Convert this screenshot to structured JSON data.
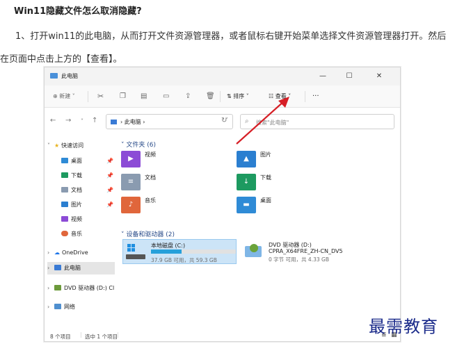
{
  "article": {
    "title": "Win11隐藏文件怎么取消隐藏?",
    "step1": "1、打开win11的此电脑，从而打开文件资源管理器，或者鼠标右键开始菜单选择文件资源管理器打开。然后在页面中点击上方的【查看】。"
  },
  "window": {
    "title": "此电脑",
    "controls": [
      "—",
      "☐",
      "✕"
    ]
  },
  "commandbar": {
    "new_label": "新建",
    "sort_label": "排序",
    "view_label": "查看",
    "more": "···"
  },
  "navigation": {
    "address": "此电脑",
    "search_placeholder": "搜索\"此电脑\""
  },
  "sidebar": {
    "quick_access": "快速访问",
    "items": [
      {
        "label": "桌面",
        "color": "#2f8bd6"
      },
      {
        "label": "下载",
        "color": "#1d9a60"
      },
      {
        "label": "文档",
        "color": "#8a9bb0"
      },
      {
        "label": "图片",
        "color": "#2b7fd0"
      },
      {
        "label": "视频",
        "color": "#8c4bd6"
      },
      {
        "label": "音乐",
        "color": "#e0663b"
      }
    ],
    "onedrive": "OneDrive",
    "this_pc": "此电脑",
    "dvd": "DVD 驱动器 (D:) Cl",
    "network": "网络"
  },
  "content": {
    "folders_header": "文件夹 (6)",
    "folders": [
      {
        "name": "视频",
        "color": "#8c4bd6",
        "glyph": "▶"
      },
      {
        "name": "图片",
        "color": "#2b7fd0",
        "glyph": "▲"
      },
      {
        "name": "文档",
        "color": "#8a9bb0",
        "glyph": "≡"
      },
      {
        "name": "下载",
        "color": "#1d9a60",
        "glyph": "↓"
      },
      {
        "name": "音乐",
        "color": "#e0663b",
        "glyph": "♪"
      },
      {
        "name": "桌面",
        "color": "#2f8bd6",
        "glyph": "▬"
      }
    ],
    "devices_header": "设备和驱动器 (2)",
    "drive_c": {
      "name": "本地磁盘 (C:)",
      "info": "37.9 GB 可用，共 59.3 GB",
      "used_fraction": 0.36
    },
    "drive_d": {
      "name": "DVD 驱动器 (D:)",
      "label": "CPRA_X64FRE_ZH-CN_DV5",
      "info": "0 字节 可用，共 4.33 GB"
    }
  },
  "status": {
    "count": "8 个项目",
    "selected": "选中 1 个项目"
  },
  "watermark": "最需教育",
  "colors": {
    "accent": "#2a4c8a",
    "arrow": "#d61f26",
    "selection": "#cce4f7"
  }
}
